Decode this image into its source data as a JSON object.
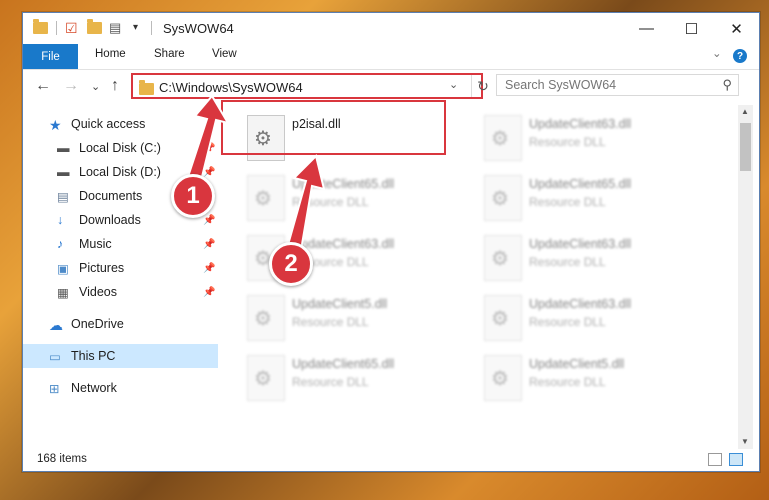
{
  "window": {
    "title": "SysWOW64",
    "minimize": "—",
    "maximize": "☐",
    "close": "✕"
  },
  "ribbon": {
    "tabs": [
      "File",
      "Home",
      "Share",
      "View"
    ],
    "chevron": "⌄",
    "help": "?"
  },
  "nav": {
    "back": "←",
    "forward": "→",
    "recent": "⌄",
    "up": "↑"
  },
  "address": {
    "path": "C:\\Windows\\SysWOW64",
    "dropdown": "⌄",
    "refresh": "↻"
  },
  "search": {
    "placeholder": "Search SysWOW64",
    "icon": "search-icon"
  },
  "sidebar": {
    "items": [
      {
        "label": "Quick access",
        "icon": "star-icon",
        "pinned": false
      },
      {
        "label": "Local Disk (C:)",
        "icon": "drive-icon",
        "pinned": true
      },
      {
        "label": "Local Disk (D:)",
        "icon": "drive-icon",
        "pinned": true
      },
      {
        "label": "Documents",
        "icon": "documents-icon",
        "pinned": true
      },
      {
        "label": "Downloads",
        "icon": "download-icon",
        "pinned": true
      },
      {
        "label": "Music",
        "icon": "music-icon",
        "pinned": true
      },
      {
        "label": "Pictures",
        "icon": "pictures-icon",
        "pinned": true
      },
      {
        "label": "Videos",
        "icon": "videos-icon",
        "pinned": true
      },
      {
        "label": "OneDrive",
        "icon": "cloud-icon",
        "pinned": false
      },
      {
        "label": "This PC",
        "icon": "computer-icon",
        "pinned": false
      },
      {
        "label": "Network",
        "icon": "network-icon",
        "pinned": false
      }
    ]
  },
  "files": [
    {
      "name": "p2isal.dll",
      "type": ""
    },
    {
      "name": "UpdateClient63.dll",
      "type": "Resource DLL"
    },
    {
      "name": "UpdateClient65.dll",
      "type": "Resource DLL"
    },
    {
      "name": "UpdateClient65.dll",
      "type": "Resource DLL"
    },
    {
      "name": "UpdateClient63.dll",
      "type": "Resource DLL"
    },
    {
      "name": "UpdateClient63.dll",
      "type": "Resource DLL"
    },
    {
      "name": "UpdateClient5.dll",
      "type": "Resource DLL"
    },
    {
      "name": "UpdateClient63.dll",
      "type": "Resource DLL"
    },
    {
      "name": "UpdateClient65.dll",
      "type": "Resource DLL"
    },
    {
      "name": "UpdateClient5.dll",
      "type": "Resource DLL"
    }
  ],
  "status": {
    "count": "168 items"
  },
  "annotations": {
    "step1": "1",
    "step2": "2",
    "color": "#d9363e"
  }
}
